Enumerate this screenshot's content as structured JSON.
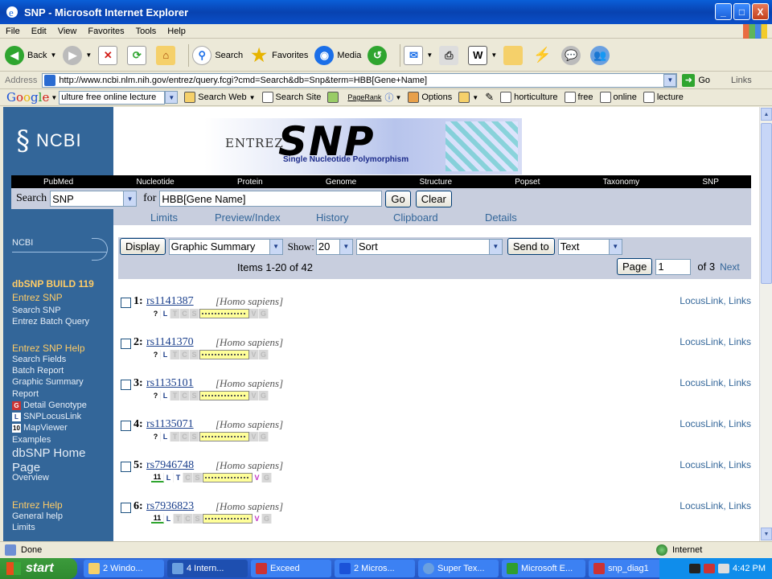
{
  "window": {
    "title": "SNP - Microsoft Internet Explorer",
    "controls": [
      "_",
      "□",
      "X"
    ]
  },
  "menu": [
    "File",
    "Edit",
    "View",
    "Favorites",
    "Tools",
    "Help"
  ],
  "toolbar": {
    "back": "Back",
    "search": "Search",
    "favorites": "Favorites",
    "media": "Media"
  },
  "address": {
    "label": "Address",
    "url": "http://www.ncbi.nlm.nih.gov/entrez/query.fcgi?cmd=Search&db=Snp&term=HBB[Gene+Name]",
    "go": "Go",
    "links": "Links"
  },
  "google": {
    "logo": [
      "G",
      "o",
      "o",
      "g",
      "l",
      "e"
    ],
    "query": "ulture free online  lecture",
    "search_web": "Search Web",
    "search_site": "Search Site",
    "pagerank": "PageRank",
    "options": "Options",
    "terms": [
      "horticulture",
      "free",
      "online",
      "lecture"
    ]
  },
  "ncbi": {
    "logo": "NCBI",
    "banner": {
      "entrez": "ENTREZ",
      "snp": "SNP",
      "subtitle": "Single Nucleotide Polymorphism"
    },
    "nav": [
      "PubMed",
      "Nucleotide",
      "Protein",
      "Genome",
      "Structure",
      "Popset",
      "Taxonomy",
      "SNP"
    ],
    "search": {
      "label": "Search",
      "db": "SNP",
      "for_label": "for",
      "term": "HBB[Gene Name]",
      "go": "Go",
      "clear": "Clear"
    },
    "subnav": [
      "Limits",
      "Preview/Index",
      "History",
      "Clipboard",
      "Details"
    ],
    "left": {
      "ncbi_link": "NCBI",
      "build": "dbSNP BUILD 119",
      "entrez_snp": "Entrez SNP",
      "search_snp": "Search SNP",
      "batch_query": "Entrez Batch Query",
      "help": "Entrez SNP Help",
      "search_fields": "Search Fields",
      "batch_report": "Batch Report",
      "graphic_summary": "Graphic Summary",
      "report": "Report",
      "detail_genotype": "Detail Genotype",
      "snplocuslink": "SNPLocusLink",
      "mapviewer": "MapViewer",
      "examples": "Examples",
      "home1": "dbSNP Home",
      "home2": "Page",
      "overview": "Overview",
      "entrez_help": "Entrez Help",
      "general_help": "General help",
      "limits": "Limits",
      "icon_g": "G",
      "icon_l": "L",
      "icon_10": "10"
    },
    "controls": {
      "display": "Display",
      "format": "Graphic Summary",
      "show_label": "Show:",
      "show": "20",
      "sort": "Sort",
      "send_to": "Send to",
      "send_format": "Text",
      "items": "Items 1-20 of 42",
      "page_btn": "Page",
      "page": "1",
      "of": "of 3",
      "next": "Next"
    },
    "results": [
      {
        "num": "1:",
        "rs": "rs1141387",
        "species": "[Homo sapiens]",
        "icons": [
          "?",
          "L",
          "T",
          "C",
          "S",
          "",
          "V",
          "G"
        ],
        "active": [
          0,
          1
        ]
      },
      {
        "num": "2:",
        "rs": "rs1141370",
        "species": "[Homo sapiens]",
        "icons": [
          "?",
          "L",
          "T",
          "C",
          "S",
          "",
          "V",
          "G"
        ],
        "active": [
          0,
          1
        ]
      },
      {
        "num": "3:",
        "rs": "rs1135101",
        "species": "[Homo sapiens]",
        "icons": [
          "?",
          "L",
          "T",
          "C",
          "S",
          "",
          "V",
          "G"
        ],
        "active": [
          0,
          1
        ]
      },
      {
        "num": "4:",
        "rs": "rs1135071",
        "species": "[Homo sapiens]",
        "icons": [
          "?",
          "L",
          "T",
          "C",
          "S",
          "",
          "V",
          "G"
        ],
        "active": [
          0,
          1
        ]
      },
      {
        "num": "5:",
        "rs": "rs7946748",
        "species": "[Homo sapiens]",
        "icons": [
          "11",
          "L",
          "T",
          "C",
          "S",
          "",
          "V",
          "G"
        ],
        "active": [
          0,
          1,
          2,
          6
        ]
      },
      {
        "num": "6:",
        "rs": "rs7936823",
        "species": "[Homo sapiens]",
        "icons": [
          "11",
          "L",
          "T",
          "C",
          "S",
          "",
          "V",
          "G"
        ],
        "active": [
          0,
          1,
          6
        ]
      }
    ],
    "links_text": "LocusLink, Links"
  },
  "status": {
    "text": "Done",
    "zone": "Internet"
  },
  "taskbar": {
    "start": "start",
    "tasks": [
      "2 Windo...",
      "4 Intern...",
      "Exceed",
      "2 Micros...",
      "Super Tex...",
      "Microsoft E...",
      "snp_diag1"
    ],
    "clock": "4:42 PM"
  },
  "colors": {
    "ncbi_blue": "#336699",
    "nav_grey": "#c8cede",
    "link": "#1a3f8c"
  }
}
